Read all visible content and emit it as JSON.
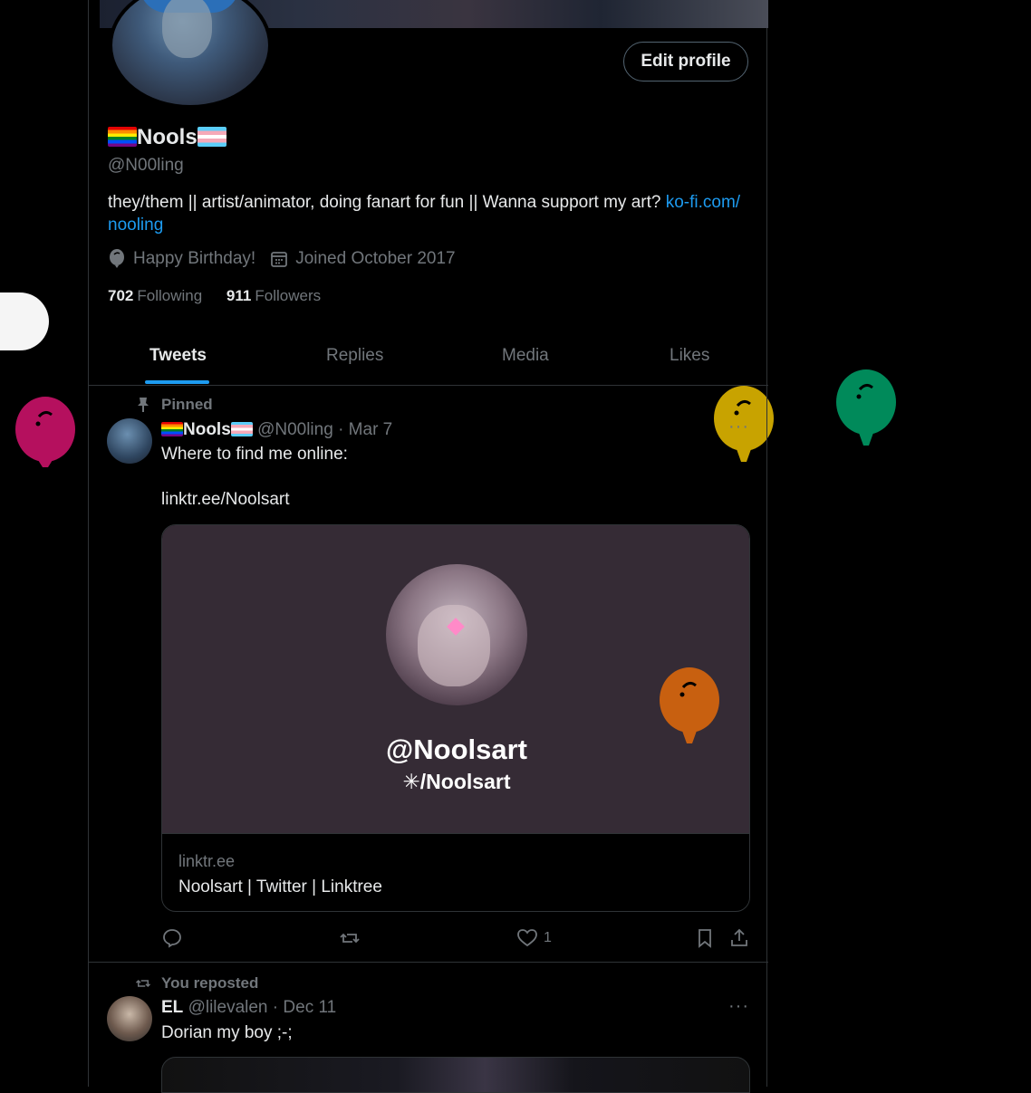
{
  "profile": {
    "name": "Nools",
    "handle": "@N00ling",
    "edit_button": "Edit profile",
    "bio_text": "they/them || artist/animator, doing fanart for fun || Wanna support my art? ",
    "bio_link": "ko-fi.com/ nooling",
    "birthday": "Happy Birthday!",
    "joined": "Joined October 2017",
    "following_count": "702",
    "following_label": "Following",
    "followers_count": "911",
    "followers_label": "Followers"
  },
  "tabs": [
    "Tweets",
    "Replies",
    "Media",
    "Likes"
  ],
  "pinned_tweet": {
    "context": "Pinned",
    "author_name": "Nools",
    "author_handle": "@N00ling",
    "sep": "·",
    "date": "Mar 7",
    "text": "Where to find me online:",
    "link": "linktr.ee/Noolsart",
    "card": {
      "title": "@Noolsart",
      "subtitle": "/Noolsart",
      "domain": "linktr.ee",
      "description": "Noolsart | Twitter | Linktree"
    },
    "like_count": "1"
  },
  "repost_tweet": {
    "context": "You reposted",
    "author_name": "EL",
    "author_handle": "@lilevalen",
    "sep": "·",
    "date": "Dec 11",
    "text": "Dorian my boy ;-;"
  },
  "more_glyph": "···",
  "colors": {
    "accent": "#1d9bf0",
    "balloon_pink": "#b5105e",
    "balloon_gold": "#c8a300",
    "balloon_green": "#008a5a",
    "balloon_orange": "#c86010"
  }
}
